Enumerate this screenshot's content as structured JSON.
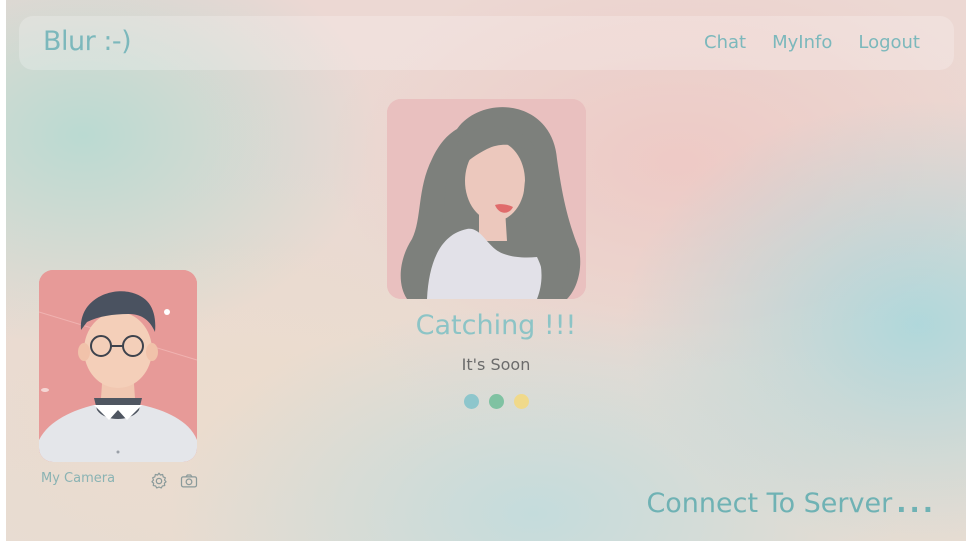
{
  "app": {
    "brand": "Blur :-)"
  },
  "nav": {
    "items": [
      {
        "label": "Chat"
      },
      {
        "label": "MyInfo"
      },
      {
        "label": "Logout"
      }
    ]
  },
  "match": {
    "title": "Catching !!!",
    "subtitle": "It's Soon"
  },
  "loader": {
    "dot_colors": [
      "#8ec6cc",
      "#7fc2a2",
      "#f0d98a"
    ]
  },
  "camera": {
    "label": "My Camera",
    "settings_icon": "gear-icon",
    "camera_icon": "camera-icon"
  },
  "status": {
    "text": "Connect To Server",
    "ellipsis": "..."
  },
  "colors": {
    "accent": "#7cb8bc",
    "partner_bg": "#e9c0bf",
    "camera_bg": "#e79a98"
  }
}
